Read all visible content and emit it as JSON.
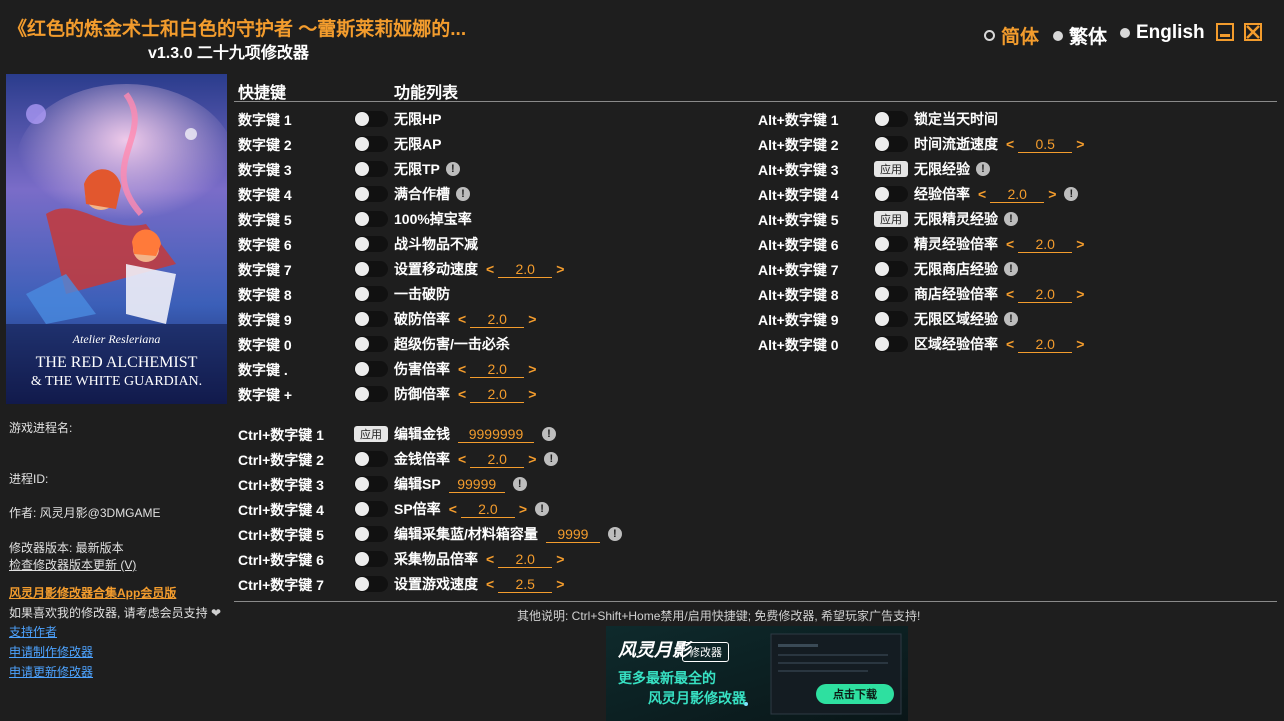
{
  "app": {
    "title": "《红色的炼金术士和白色的守护者 ～蕾斯莱莉娅娜的...",
    "subtitle": "v1.3.0 二十九项修改器"
  },
  "languages": [
    {
      "label": "简体",
      "selected": true
    },
    {
      "label": "繁体",
      "selected": false
    },
    {
      "label": "English",
      "selected": false
    }
  ],
  "cover": {
    "logo_line1": "Atelier Resleriana",
    "logo_line2": "THE RED ALCHEMIST",
    "logo_line3": "& THE WHITE GUARDIAN."
  },
  "sidebar": {
    "process_name_label": "游戏进程名:",
    "process_id_label": "进程ID:",
    "author": "作者: 风灵月影@3DMGAME",
    "version": "修改器版本: 最新版本",
    "check_update": "检查修改器版本更新 (V)",
    "app_promo": "风灵月影修改器合集App会员版",
    "support_text": "如果喜欢我的修改器, 请考虑会员支持",
    "heart_icon": "heart-icon",
    "link_support": "支持作者",
    "link_request": "申请制作修改器",
    "link_update": "申请更新修改器"
  },
  "headers": {
    "hotkey": "快捷键",
    "features": "功能列表"
  },
  "colors": {
    "accent": "#f39c2d",
    "background": "#1e1e1e",
    "link": "#4da3ff"
  },
  "cheats_left": [
    {
      "key": "数字键 1",
      "control": "toggle",
      "label": "无限HP"
    },
    {
      "key": "数字键 2",
      "control": "toggle",
      "label": "无限AP"
    },
    {
      "key": "数字键 3",
      "control": "toggle",
      "label": "无限TP",
      "warn": true
    },
    {
      "key": "数字键 4",
      "control": "toggle",
      "label": "满合作槽",
      "warn": true
    },
    {
      "key": "数字键 5",
      "control": "toggle",
      "label": "100%掉宝率"
    },
    {
      "key": "数字键 6",
      "control": "toggle",
      "label": "战斗物品不减"
    },
    {
      "key": "数字键 7",
      "control": "toggle",
      "label": "设置移动速度",
      "value": "2.0",
      "arrows": true
    },
    {
      "key": "数字键 8",
      "control": "toggle",
      "label": "一击破防"
    },
    {
      "key": "数字键 9",
      "control": "toggle",
      "label": "破防倍率",
      "value": "2.0",
      "arrows": true
    },
    {
      "key": "数字键 0",
      "control": "toggle",
      "label": "超级伤害/一击必杀"
    },
    {
      "key": "数字键 .",
      "control": "toggle",
      "label": "伤害倍率",
      "value": "2.0",
      "arrows": true
    },
    {
      "key": "数字键 +",
      "control": "toggle",
      "label": "防御倍率",
      "value": "2.0",
      "arrows": true
    }
  ],
  "cheats_ctrl": [
    {
      "key": "Ctrl+数字键 1",
      "control": "apply",
      "label": "编辑金钱",
      "value": "9999999",
      "warn": true
    },
    {
      "key": "Ctrl+数字键 2",
      "control": "toggle",
      "label": "金钱倍率",
      "value": "2.0",
      "arrows": true,
      "warn": true
    },
    {
      "key": "Ctrl+数字键 3",
      "control": "toggle",
      "label": "编辑SP",
      "value": "99999",
      "warn": true
    },
    {
      "key": "Ctrl+数字键 4",
      "control": "toggle",
      "label": "SP倍率",
      "value": "2.0",
      "arrows": true,
      "warn": true
    },
    {
      "key": "Ctrl+数字键 5",
      "control": "toggle",
      "label": "编辑采集蓝/材料箱容量",
      "value": "9999",
      "warn": true
    },
    {
      "key": "Ctrl+数字键 6",
      "control": "toggle",
      "label": "采集物品倍率",
      "value": "2.0",
      "arrows": true
    },
    {
      "key": "Ctrl+数字键 7",
      "control": "toggle",
      "label": "设置游戏速度",
      "value": "2.5",
      "arrows": true
    }
  ],
  "cheats_alt": [
    {
      "key": "Alt+数字键 1",
      "control": "toggle",
      "label": "锁定当天时间"
    },
    {
      "key": "Alt+数字键 2",
      "control": "toggle",
      "label": "时间流逝速度",
      "value": "0.5",
      "arrows": true
    },
    {
      "key": "Alt+数字键 3",
      "control": "apply",
      "label": "无限经验",
      "warn": true
    },
    {
      "key": "Alt+数字键 4",
      "control": "toggle",
      "label": "经验倍率",
      "value": "2.0",
      "arrows": true,
      "warn": true
    },
    {
      "key": "Alt+数字键 5",
      "control": "apply",
      "label": "无限精灵经验",
      "warn": true
    },
    {
      "key": "Alt+数字键 6",
      "control": "toggle",
      "label": "精灵经验倍率",
      "value": "2.0",
      "arrows": true
    },
    {
      "key": "Alt+数字键 7",
      "control": "toggle",
      "label": "无限商店经验",
      "warn": true
    },
    {
      "key": "Alt+数字键 8",
      "control": "toggle",
      "label": "商店经验倍率",
      "value": "2.0",
      "arrows": true
    },
    {
      "key": "Alt+数字键 9",
      "control": "toggle",
      "label": "无限区域经验",
      "warn": true
    },
    {
      "key": "Alt+数字键 0",
      "control": "toggle",
      "label": "区域经验倍率",
      "value": "2.0",
      "arrows": true
    }
  ],
  "apply_label": "应用",
  "warn_glyph": "!",
  "arrow_left": "<",
  "arrow_right": ">",
  "footer": {
    "note": "其他说明: Ctrl+Shift+Home禁用/启用快捷键; 免费修改器, 希望玩家广告支持!"
  },
  "ad": {
    "brand": "风灵月影",
    "tag": "修改器",
    "line1": "更多最新最全的",
    "line2": "风灵月影修改器",
    "button": "点击下载"
  }
}
